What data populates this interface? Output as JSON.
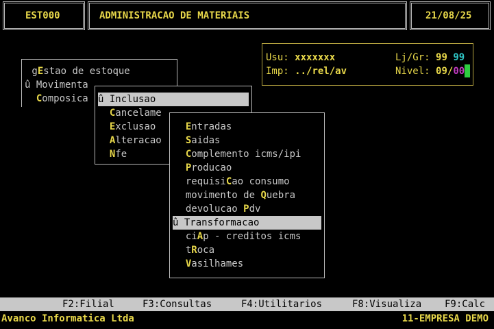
{
  "header": {
    "program_code": "EST000",
    "system_title": "ADMINISTRACAO DE MATERIAIS",
    "date": "21/08/25"
  },
  "info_panel": {
    "user_label": "Usu:",
    "user_value": "xxxxxxx",
    "store_label": "Lj/Gr:",
    "store_value": "99",
    "group_value": "99",
    "printer_label": "Imp:",
    "printer_value": "../rel/av",
    "level_label": "Nivel:",
    "level_value": "09/",
    "level_sub": "00"
  },
  "main_menu": {
    "items": [
      {
        "pre": " g",
        "hot": "E",
        "post": "stao de estoque"
      },
      {
        "pre": "û Movimenta",
        "hot": "",
        "post": ""
      },
      {
        "pre": "  ",
        "hot": "C",
        "post": "omposica"
      }
    ]
  },
  "sub_menu": {
    "items": [
      {
        "pre": "û Inclusao",
        "hot": "",
        "post": ""
      },
      {
        "pre": "  ",
        "hot": "C",
        "post": "ancelame"
      },
      {
        "pre": "  ",
        "hot": "E",
        "post": "xclusao"
      },
      {
        "pre": "  ",
        "hot": "A",
        "post": "lteracao"
      },
      {
        "pre": "  ",
        "hot": "N",
        "post": "fe"
      }
    ]
  },
  "inclusion_menu": {
    "items": [
      {
        "pre": "  ",
        "hot": "E",
        "post": "ntradas"
      },
      {
        "pre": "  ",
        "hot": "S",
        "post": "aidas"
      },
      {
        "pre": "  ",
        "hot": "C",
        "post": "omplemento icms/ipi"
      },
      {
        "pre": "  ",
        "hot": "P",
        "post": "roducao"
      },
      {
        "pre": "  requisi",
        "hot": "C",
        "post": "ao consumo"
      },
      {
        "pre": "  movimento de ",
        "hot": "Q",
        "post": "uebra"
      },
      {
        "pre": "  devolucao ",
        "hot": "P",
        "post": "dv"
      },
      {
        "pre": "û Transformacao",
        "hot": "",
        "post": ""
      },
      {
        "pre": "  ci",
        "hot": "A",
        "post": "p - creditos icms"
      },
      {
        "pre": "  t",
        "hot": "R",
        "post": "oca"
      },
      {
        "pre": "  ",
        "hot": "V",
        "post": "asilhames"
      }
    ]
  },
  "function_keys": [
    "F2:Filial",
    "F3:Consultas",
    "F4:Utilitarios",
    "F8:Visualiza",
    "F9:Calc"
  ],
  "status_bar": {
    "company": "Avanco Informatica Ltda",
    "branch": "11-EMPRESA DEMO"
  },
  "colors": {
    "background": "#000000",
    "highlight": "#e8d84a",
    "selection": "#c8c8c8",
    "cursor": "#2ecc40"
  }
}
